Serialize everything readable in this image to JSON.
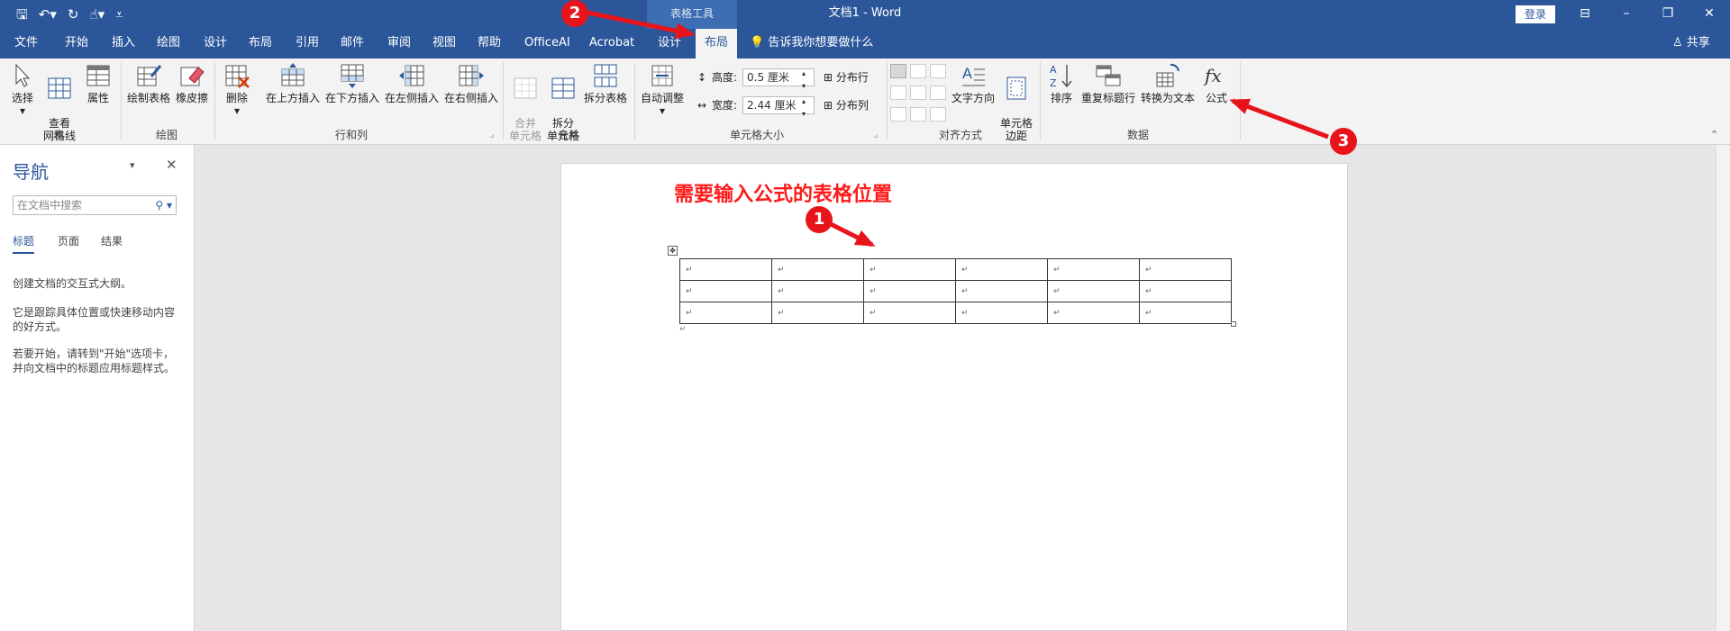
{
  "titlebar": {
    "context_group": "表格工具",
    "doc_title": "文档1 - Word",
    "login": "登录",
    "qat_icons": [
      "save-icon",
      "undo-icon",
      "redo-icon",
      "touch-mode-icon",
      "customize-icon"
    ]
  },
  "tabs": [
    "文件",
    "开始",
    "插入",
    "绘图",
    "设计",
    "布局",
    "引用",
    "邮件",
    "审阅",
    "视图",
    "帮助",
    "OfficeAI",
    "Acrobat",
    "设计",
    "布局"
  ],
  "tell_me": "告诉我你想要做什么",
  "share": "共享",
  "ribbon": {
    "groups": [
      "表",
      "绘图",
      "行和列",
      "合并",
      "单元格大小",
      "对齐方式",
      "数据"
    ],
    "buttons": {
      "select": "选择",
      "view_gridlines": "查看\n网格线",
      "properties": "属性",
      "draw_table": "绘制表格",
      "eraser": "橡皮擦",
      "delete": "删除",
      "insert_above": "在上方插入",
      "insert_below": "在下方插入",
      "insert_left": "在左侧插入",
      "insert_right": "在右侧插入",
      "merge_cells": "合并\n单元格",
      "split_cells": "拆分\n单元格",
      "split_table": "拆分表格",
      "autofit": "自动调整",
      "height_label": "高度:",
      "height_value": "0.5 厘米",
      "width_label": "宽度:",
      "width_value": "2.44 厘米",
      "distribute_rows": "分布行",
      "distribute_cols": "分布列",
      "text_direction": "文字方向",
      "cell_margins": "单元格\n边距",
      "sort": "排序",
      "repeat_header": "重复标题行",
      "convert_to_text": "转换为文本",
      "formula": "公式"
    }
  },
  "nav": {
    "title": "导航",
    "search_placeholder": "在文档中搜索",
    "tabs": [
      "标题",
      "页面",
      "结果"
    ],
    "p1": "创建文档的交互式大纲。",
    "p2": "它是跟踪具体位置或快速移动内容的好方式。",
    "p3": "若要开始，请转到\"开始\"选项卡，并向文档中的标题应用标题样式。"
  },
  "page": {
    "annotation_title": "需要输入公式的表格位置"
  },
  "table": {
    "rows": 3,
    "cols": 6,
    "cell_mark": "↵"
  },
  "annotations": {
    "badges": [
      "1",
      "2",
      "3"
    ],
    "arrow_color": "#e8141c"
  },
  "colors": {
    "accent": "#2b579a",
    "annotation": "#ff1a1a"
  }
}
